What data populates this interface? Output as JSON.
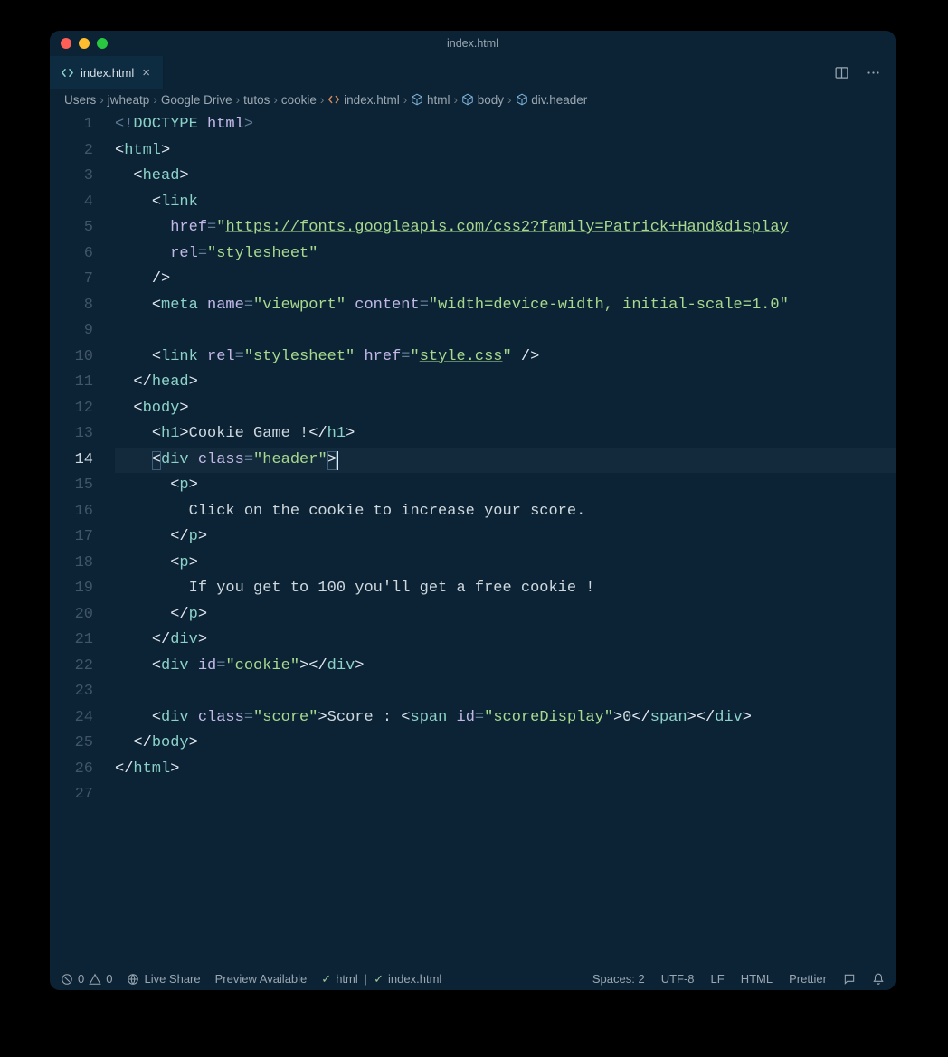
{
  "window": {
    "title": "index.html"
  },
  "tab": {
    "label": "index.html"
  },
  "breadcrumbs": [
    "Users",
    "jwheatp",
    "Google Drive",
    "tutos",
    "cookie",
    "index.html",
    "html",
    "body",
    "div.header"
  ],
  "breadcrumb_icons": {
    "file_at": 5,
    "cube_at": [
      6,
      7,
      8
    ]
  },
  "active_line": 14,
  "line_count": 27,
  "code_tokens": [
    [
      [
        "punct",
        "<!"
      ],
      [
        "tagname",
        "DOCTYPE"
      ],
      [
        "text",
        " "
      ],
      [
        "attr",
        "html"
      ],
      [
        "punct",
        ">"
      ]
    ],
    [
      [
        "tagang",
        "<"
      ],
      [
        "tagname",
        "html"
      ],
      [
        "tagang",
        ">"
      ]
    ],
    [
      [
        "text",
        "  "
      ],
      [
        "tagang",
        "<"
      ],
      [
        "tagname",
        "head"
      ],
      [
        "tagang",
        ">"
      ]
    ],
    [
      [
        "text",
        "    "
      ],
      [
        "tagang",
        "<"
      ],
      [
        "tagname",
        "link"
      ]
    ],
    [
      [
        "text",
        "      "
      ],
      [
        "attr",
        "href"
      ],
      [
        "punct",
        "="
      ],
      [
        "str",
        "\""
      ],
      [
        "str underline",
        "https://fonts.googleapis.com/css2?family=Patrick+Hand&display"
      ]
    ],
    [
      [
        "text",
        "      "
      ],
      [
        "attr",
        "rel"
      ],
      [
        "punct",
        "="
      ],
      [
        "str",
        "\"stylesheet\""
      ]
    ],
    [
      [
        "text",
        "    "
      ],
      [
        "tagang",
        "/>"
      ]
    ],
    [
      [
        "text",
        "    "
      ],
      [
        "tagang",
        "<"
      ],
      [
        "tagname",
        "meta"
      ],
      [
        "text",
        " "
      ],
      [
        "attr",
        "name"
      ],
      [
        "punct",
        "="
      ],
      [
        "str",
        "\"viewport\""
      ],
      [
        "text",
        " "
      ],
      [
        "attr",
        "content"
      ],
      [
        "punct",
        "="
      ],
      [
        "str",
        "\"width=device-width, initial-scale=1.0\""
      ]
    ],
    [],
    [
      [
        "text",
        "    "
      ],
      [
        "tagang",
        "<"
      ],
      [
        "tagname",
        "link"
      ],
      [
        "text",
        " "
      ],
      [
        "attr",
        "rel"
      ],
      [
        "punct",
        "="
      ],
      [
        "str",
        "\"stylesheet\""
      ],
      [
        "text",
        " "
      ],
      [
        "attr",
        "href"
      ],
      [
        "punct",
        "="
      ],
      [
        "str",
        "\""
      ],
      [
        "str underline",
        "style.css"
      ],
      [
        "str",
        "\""
      ],
      [
        "text",
        " "
      ],
      [
        "tagang",
        "/>"
      ]
    ],
    [
      [
        "text",
        "  "
      ],
      [
        "tagang",
        "</"
      ],
      [
        "tagname",
        "head"
      ],
      [
        "tagang",
        ">"
      ]
    ],
    [
      [
        "text",
        "  "
      ],
      [
        "tagang",
        "<"
      ],
      [
        "tagname",
        "body"
      ],
      [
        "tagang",
        ">"
      ]
    ],
    [
      [
        "text",
        "    "
      ],
      [
        "tagang",
        "<"
      ],
      [
        "tagname",
        "h1"
      ],
      [
        "tagang",
        ">"
      ],
      [
        "text",
        "Cookie Game !"
      ],
      [
        "tagang",
        "</"
      ],
      [
        "tagname",
        "h1"
      ],
      [
        "tagang",
        ">"
      ]
    ],
    [
      [
        "text",
        "    "
      ],
      [
        "tagang",
        "<"
      ],
      [
        "tagname",
        "div"
      ],
      [
        "text",
        " "
      ],
      [
        "attr",
        "class"
      ],
      [
        "punct",
        "="
      ],
      [
        "str",
        "\"header\""
      ],
      [
        "tagang",
        ">"
      ]
    ],
    [
      [
        "text",
        "      "
      ],
      [
        "tagang",
        "<"
      ],
      [
        "tagname",
        "p"
      ],
      [
        "tagang",
        ">"
      ]
    ],
    [
      [
        "text",
        "        Click on the cookie to increase your score."
      ]
    ],
    [
      [
        "text",
        "      "
      ],
      [
        "tagang",
        "</"
      ],
      [
        "tagname",
        "p"
      ],
      [
        "tagang",
        ">"
      ]
    ],
    [
      [
        "text",
        "      "
      ],
      [
        "tagang",
        "<"
      ],
      [
        "tagname",
        "p"
      ],
      [
        "tagang",
        ">"
      ]
    ],
    [
      [
        "text",
        "        If you get to 100 you'll get a free cookie !"
      ]
    ],
    [
      [
        "text",
        "      "
      ],
      [
        "tagang",
        "</"
      ],
      [
        "tagname",
        "p"
      ],
      [
        "tagang",
        ">"
      ]
    ],
    [
      [
        "text",
        "    "
      ],
      [
        "tagang",
        "</"
      ],
      [
        "tagname",
        "div"
      ],
      [
        "tagang",
        ">"
      ]
    ],
    [
      [
        "text",
        "    "
      ],
      [
        "tagang",
        "<"
      ],
      [
        "tagname",
        "div"
      ],
      [
        "text",
        " "
      ],
      [
        "attr",
        "id"
      ],
      [
        "punct",
        "="
      ],
      [
        "str",
        "\"cookie\""
      ],
      [
        "tagang",
        "></"
      ],
      [
        "tagname",
        "div"
      ],
      [
        "tagang",
        ">"
      ]
    ],
    [],
    [
      [
        "text",
        "    "
      ],
      [
        "tagang",
        "<"
      ],
      [
        "tagname",
        "div"
      ],
      [
        "text",
        " "
      ],
      [
        "attr",
        "class"
      ],
      [
        "punct",
        "="
      ],
      [
        "str",
        "\"score\""
      ],
      [
        "tagang",
        ">"
      ],
      [
        "text",
        "Score : "
      ],
      [
        "tagang",
        "<"
      ],
      [
        "tagname",
        "span"
      ],
      [
        "text",
        " "
      ],
      [
        "attr",
        "id"
      ],
      [
        "punct",
        "="
      ],
      [
        "str",
        "\"scoreDisplay\""
      ],
      [
        "tagang",
        ">"
      ],
      [
        "text",
        "0"
      ],
      [
        "tagang",
        "</"
      ],
      [
        "tagname",
        "span"
      ],
      [
        "tagang",
        "></"
      ],
      [
        "tagname",
        "div"
      ],
      [
        "tagang",
        ">"
      ]
    ],
    [
      [
        "text",
        "  "
      ],
      [
        "tagang",
        "</"
      ],
      [
        "tagname",
        "body"
      ],
      [
        "tagang",
        ">"
      ]
    ],
    [
      [
        "tagang",
        "</"
      ],
      [
        "tagname",
        "html"
      ],
      [
        "tagang",
        ">"
      ]
    ],
    []
  ],
  "status": {
    "errors": "0",
    "warnings": "0",
    "liveshare": "Live Share",
    "preview": "Preview Available",
    "lang_l": "html",
    "lang_r": "index.html",
    "spaces": "Spaces: 2",
    "encoding": "UTF-8",
    "eol": "LF",
    "mode": "HTML",
    "formatter": "Prettier"
  }
}
